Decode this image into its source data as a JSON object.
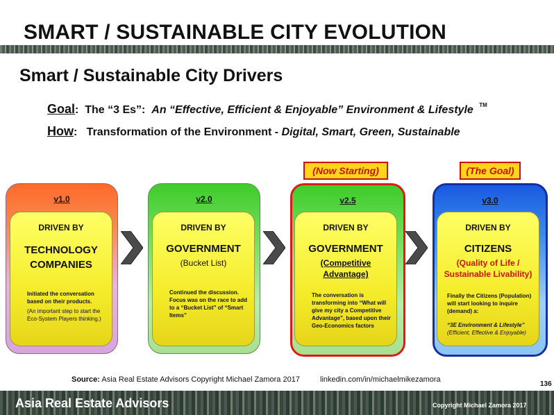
{
  "header": {
    "title": "SMART / SUSTAINABLE CITY EVOLUTION"
  },
  "subtitle": "Smart / Sustainable City Drivers",
  "goal": {
    "key": "Goal",
    "colon": ":",
    "text": "The “3 Es”:",
    "italic": "An “Effective, Efficient & Enjoyable” Environment & Lifestyle",
    "tm": "TM"
  },
  "how": {
    "key": "How",
    "colon": ":",
    "text": "Transformation of the Environment -",
    "italic": "Digital, Smart, Green, Sustainable"
  },
  "tags": {
    "now_starting": "(Now Starting)",
    "the_goal": "(The Goal)"
  },
  "cards": [
    {
      "version": "v1.0",
      "driven_by": "DRIVEN BY",
      "big1": "TECHNOLOGY",
      "big2": "COMPANIES",
      "note": "Initiated the conversation based on their products.",
      "note2": "(An important step to start the Eco-System Players thinking.)"
    },
    {
      "version": "v2.0",
      "driven_by": "DRIVEN BY",
      "big1": "GOVERNMENT",
      "sub": "(Bucket List)",
      "note": "Continued the discussion. Focus was on the race to add to a “Bucket List” of “Smart Items”"
    },
    {
      "version": "v2.5",
      "driven_by": "DRIVEN BY",
      "big1": "GOVERNMENT",
      "sub1": "(Competitive",
      "sub2": "Advantage)",
      "note": "The conversation is transforming into “What will give my city a Competitive Advantage”, based upon their Geo-Economics factors"
    },
    {
      "version": "v3.0",
      "driven_by": "DRIVEN BY",
      "big1": "CITIZENS",
      "sub1": "(Quality of Life /",
      "sub2": "Sustainable Livability)",
      "note": "Finally the Citizens (Population) will start looking to inquire (demand) a:",
      "note2": "“3E Environment & Lifestyle”",
      "note3": "(Efficient, Effective & Enjoyable)"
    }
  ],
  "source": {
    "label": "Source:",
    "text": "Asia Real Estate Advisors  Copyright Michael Zamora 2017",
    "link": "linkedin.com/in/michaelmikezamora"
  },
  "page_number": "136",
  "footer": {
    "brand": "Asia Real Estate Advisors",
    "copyright": "Copyright Michael Zamora 2017"
  },
  "colors": {
    "tag_bg": "#ffd61a",
    "tag_text": "#c81010",
    "inner_yellow": "#f4ec2a",
    "v3_border": "#1430a0",
    "v25_border": "#e01818"
  },
  "icons": [
    "chevron-right-icon"
  ]
}
